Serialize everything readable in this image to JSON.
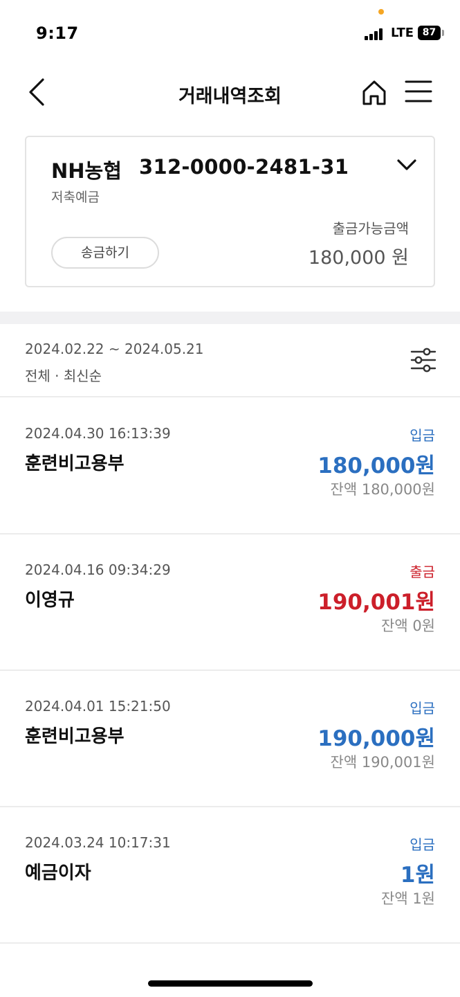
{
  "status": {
    "time": "9:17",
    "network": "LTE",
    "battery": "87"
  },
  "nav": {
    "title": "거래내역조회"
  },
  "account": {
    "bank": "NH농협",
    "number": "312-0000-2481-31",
    "type": "저축예금",
    "transfer_label": "송금하기",
    "available_label": "출금가능금액",
    "available_amount": "180,000 원"
  },
  "filter": {
    "range": "2024.02.22 ~ 2024.05.21",
    "sort": "전체 · 최신순"
  },
  "transactions": [
    {
      "date": "2024.04.30 16:13:39",
      "name": "훈련비고용부",
      "type": "입금",
      "amount": "180,000원",
      "balance": "잔액 180,000원"
    },
    {
      "date": "2024.04.16 09:34:29",
      "name": "이영규",
      "type": "출금",
      "amount": "190,001원",
      "balance": "잔액 0원"
    },
    {
      "date": "2024.04.01 15:21:50",
      "name": "훈련비고용부",
      "type": "입금",
      "amount": "190,000원",
      "balance": "잔액 190,001원"
    },
    {
      "date": "2024.03.24 10:17:31",
      "name": "예금이자",
      "type": "입금",
      "amount": "1원",
      "balance": "잔액 1원"
    }
  ],
  "colors": {
    "deposit": "#2b6fc0",
    "withdraw": "#cc1f2a",
    "status_dot": "#f5a623"
  },
  "icons": {
    "back": "chevron-left-icon",
    "home": "home-icon",
    "menu": "hamburger-menu-icon",
    "toggle": "chevron-down-icon",
    "filter": "sliders-icon",
    "signal": "cellular-signal-icon",
    "battery": "battery-icon"
  }
}
